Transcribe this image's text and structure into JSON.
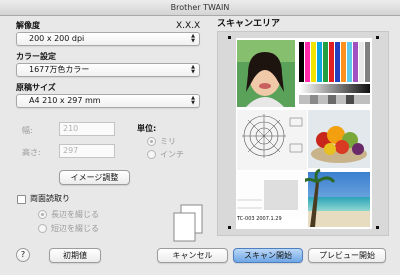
{
  "window": {
    "title": "Brother TWAIN"
  },
  "resolution": {
    "label": "解像度",
    "value": "200 x 200 dpi",
    "xxx": "X.X.X"
  },
  "color": {
    "label": "カラー設定",
    "value": "1677万色カラー"
  },
  "doc_size": {
    "label": "原稿サイズ",
    "value": "A4  210 x 297 mm"
  },
  "width": {
    "label": "幅:",
    "value": "210"
  },
  "height": {
    "label": "高さ:",
    "value": "297"
  },
  "unit": {
    "label": "単位:",
    "mm": "ミリ",
    "inch": "インチ",
    "selected": "ミリ"
  },
  "adjust_button": "イメージ調整",
  "duplex": {
    "label": "両面読取り",
    "long_edge": "長辺を綴じる",
    "short_edge": "短辺を綴じる",
    "checked": false
  },
  "scan_area": {
    "label": "スキャンエリア"
  },
  "preview_sample": {
    "code": "TC-003  2007.1.29"
  },
  "buttons": {
    "help": "?",
    "defaults": "初期値",
    "cancel": "キャンセル",
    "scan": "スキャン開始",
    "prescan": "プレビュー開始"
  }
}
